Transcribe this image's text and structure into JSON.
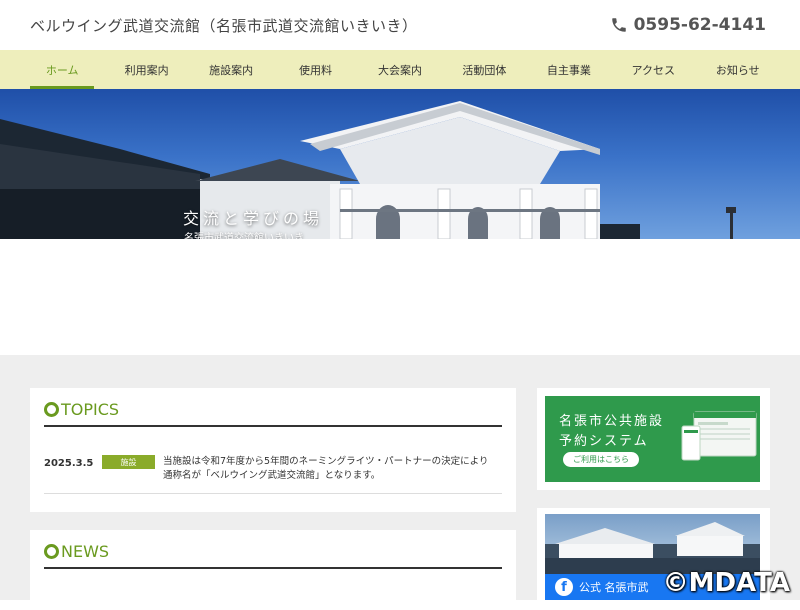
{
  "header": {
    "site_title": "ベルウイング武道交流館（名張市武道交流館いきいき）",
    "phone": "0595-62-4141"
  },
  "nav": {
    "items": [
      {
        "label": "ホーム"
      },
      {
        "label": "利用案内"
      },
      {
        "label": "施設案内"
      },
      {
        "label": "使用料"
      },
      {
        "label": "大会案内"
      },
      {
        "label": "活動団体"
      },
      {
        "label": "自主事業"
      },
      {
        "label": "アクセス"
      },
      {
        "label": "お知らせ"
      }
    ],
    "active_index": 0
  },
  "hero": {
    "caption": "交流と学びの場",
    "subcaption": "名張市武道交流館いきいき"
  },
  "topics": {
    "heading": "TOPICS",
    "items": [
      {
        "date": "2025.3.5",
        "category": "施設",
        "text": "当施設は令和7年度から5年間のネーミングライツ・パートナーの決定により通称名が「ベルウイング武道交流館」となります。"
      }
    ]
  },
  "news": {
    "heading": "NEWS"
  },
  "sidebar": {
    "reservation_banner": {
      "line1": "名張市公共施設",
      "line2": "予約システム",
      "button": "ご利用はこちら"
    },
    "facebook": {
      "label": "公式 名張市武"
    }
  },
  "watermark": "©MDATA",
  "colors": {
    "accent_green": "#6a9a1f",
    "nav_background": "#eeeebc",
    "badge_green": "#8aab2a",
    "banner_green": "#2f9a4c",
    "facebook_blue": "#1877f2"
  },
  "icons": {
    "phone": "phone-icon",
    "facebook": "facebook-icon"
  }
}
